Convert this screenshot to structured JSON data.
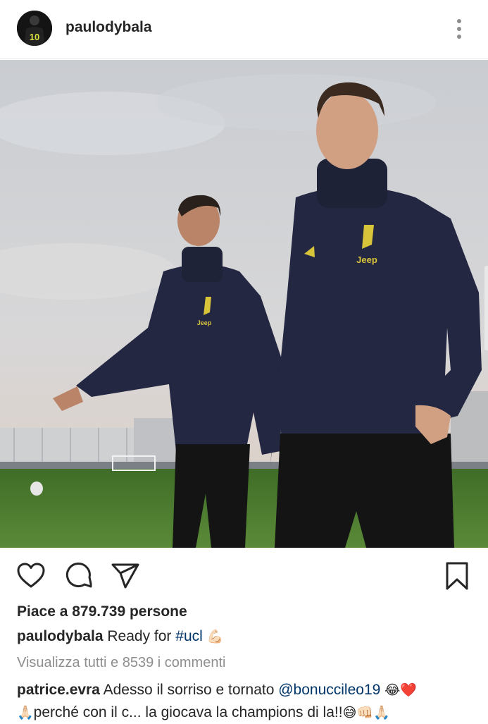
{
  "post": {
    "username": "paulodybala",
    "avatar_label": "10"
  },
  "photo": {
    "description_icon": "photo",
    "jersey_text": "Jeep"
  },
  "actions": {
    "icons": [
      "heart-icon",
      "comment-icon",
      "share-icon",
      "bookmark-icon"
    ]
  },
  "likes": {
    "text": "Piace a 879.739 persone"
  },
  "caption": {
    "username": "paulodybala",
    "text": "Ready for ",
    "hashtag": "#ucl",
    "emoji": "💪🏻"
  },
  "comments": {
    "view_all": "Visualizza tutti e 8539 i commenti",
    "first": {
      "username": "patrice.evra",
      "text_1": "Adesso il sorriso e tornato ",
      "mention": "@bonuccileo19",
      "emoji_1": "😂❤️",
      "emoji_2": "🙏🏻",
      "text_2": "perché con il c... la giocava la champions di la!!",
      "emoji_3": "😅👊🏻🙏🏻"
    }
  },
  "colors": {
    "text": "#262626",
    "muted": "#8e8e8e",
    "link": "#003569",
    "jersey": "#232741",
    "logo_yellow": "#d8c43a",
    "pitch": "#4c7a2f"
  }
}
